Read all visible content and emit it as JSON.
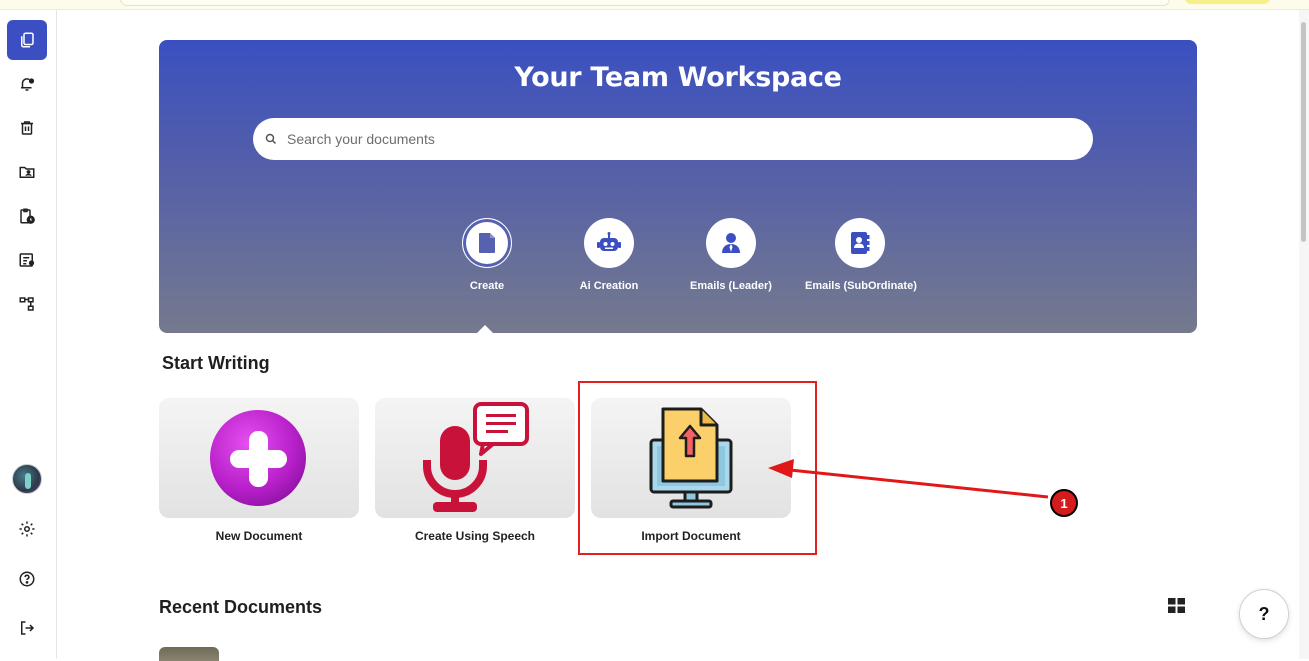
{
  "hero": {
    "title": "Your Team Workspace",
    "search_placeholder": "Search your documents",
    "actions": [
      {
        "label": "Create",
        "icon": "document-icon"
      },
      {
        "label": "Ai Creation",
        "icon": "robot-icon"
      },
      {
        "label": "Emails (Leader)",
        "icon": "leader-icon"
      },
      {
        "label": "Emails (SubOrdinate)",
        "icon": "contact-book-icon"
      }
    ]
  },
  "start_writing": {
    "title": "Start Writing",
    "cards": [
      {
        "label": "New Document",
        "icon": "plus-circle-icon"
      },
      {
        "label": "Create Using Speech",
        "icon": "microphone-icon"
      },
      {
        "label": "Import Document",
        "icon": "upload-document-icon"
      }
    ]
  },
  "recent": {
    "title": "Recent Documents"
  },
  "annotation": {
    "step_number": "1"
  },
  "help_label": "?",
  "sidebar": {
    "items": [
      "documents-icon",
      "notification-icon",
      "trash-icon",
      "shared-folder-icon",
      "clipboard-clock-icon",
      "form-icon",
      "org-chart-icon",
      "settings-icon",
      "help-circle-icon",
      "logout-icon"
    ]
  },
  "colors": {
    "accent": "#3c4fc2",
    "highlight": "#e02020"
  }
}
